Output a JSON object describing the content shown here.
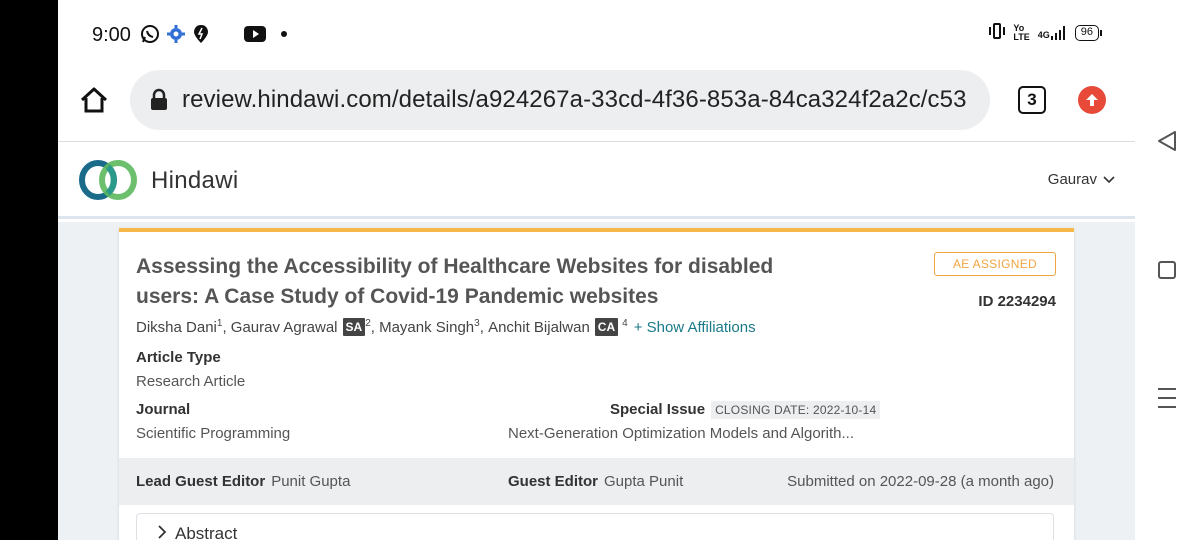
{
  "status_bar": {
    "time": "9:00",
    "icons": [
      "whatsapp-icon",
      "settings-icon",
      "pin-icon",
      "youtube-icon",
      "dot-icon"
    ],
    "right_icons": [
      "vibrate-icon",
      "volte-icon",
      "4g-signal-icon"
    ],
    "network": "4G",
    "battery": "96"
  },
  "browser": {
    "url": "review.hindawi.com/details/a924267a-33cd-4f36-853a-84ca324f2a2c/c53",
    "tab_count": "3"
  },
  "site": {
    "brand": "Hindawi",
    "user": "Gaurav"
  },
  "manuscript": {
    "title": "Assessing the Accessibility of Healthcare Websites for disabled users: A Case Study of Covid-19 Pandemic websites",
    "status": "AE ASSIGNED",
    "id": "ID 2234294",
    "authors": [
      {
        "name": "Diksha Dani",
        "sup": "1",
        "role": ""
      },
      {
        "name": "Gaurav Agrawal",
        "sup": "2",
        "role": "SA"
      },
      {
        "name": "Mayank Singh",
        "sup": "3",
        "role": ""
      },
      {
        "name": "Anchit Bijalwan",
        "sup": "4",
        "role": "CA"
      }
    ],
    "show_affiliations": "+ Show Affiliations",
    "article_type_label": "Article Type",
    "article_type": "Research Article",
    "journal_label": "Journal",
    "journal": "Scientific Programming",
    "special_issue_label": "Special Issue",
    "closing_date": "CLOSING DATE: 2022-10-14",
    "special_issue": "Next-Generation Optimization Models and Algorith...",
    "lead_guest_editor_label": "Lead Guest Editor",
    "lead_guest_editor": "Punit Gupta",
    "guest_editor_label": "Guest Editor",
    "guest_editor": "Gupta Punit",
    "submitted": "Submitted on 2022-09-28 (a month ago)",
    "abstract_label": "Abstract"
  },
  "colors": {
    "accent_orange": "#f5b84a",
    "badge_orange": "#f2a541",
    "link_teal": "#1a7a8a",
    "update_red": "#e84a3a"
  }
}
